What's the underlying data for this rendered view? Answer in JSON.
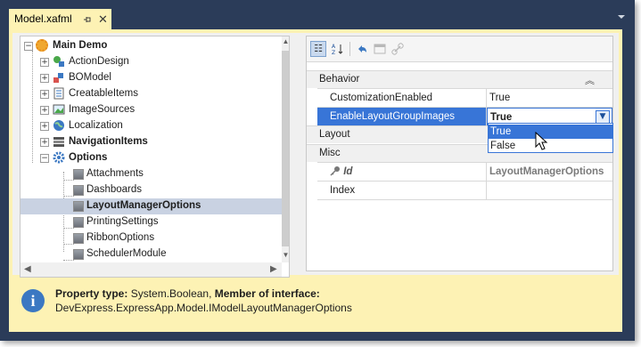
{
  "window": {
    "tab_title": "Model.xafml",
    "pin_glyph": "⌘",
    "close_glyph": "✕"
  },
  "tree": {
    "nodes": [
      {
        "label": "Main Demo",
        "bold": true,
        "expander": "−",
        "icon": "gear-orange-icon"
      },
      {
        "label": "ActionDesign",
        "bold": false,
        "expander": "+",
        "icon": "action-design-icon"
      },
      {
        "label": "BOModel",
        "bold": false,
        "expander": "+",
        "icon": "bomodel-icon"
      },
      {
        "label": "CreatableItems",
        "bold": false,
        "expander": "+",
        "icon": "creatable-items-icon"
      },
      {
        "label": "ImageSources",
        "bold": false,
        "expander": "+",
        "icon": "image-sources-icon"
      },
      {
        "label": "Localization",
        "bold": false,
        "expander": "+",
        "icon": "globe-icon"
      },
      {
        "label": "NavigationItems",
        "bold": true,
        "expander": "+",
        "icon": "navigation-icon"
      },
      {
        "label": "Options",
        "bold": true,
        "expander": "−",
        "icon": "gear-blue-icon"
      },
      {
        "label": "Attachments",
        "bold": false,
        "icon": "node-square-icon"
      },
      {
        "label": "Dashboards",
        "bold": false,
        "icon": "node-square-icon"
      },
      {
        "label": "LayoutManagerOptions",
        "bold": true,
        "icon": "node-square-icon",
        "selected": true
      },
      {
        "label": "PrintingSettings",
        "bold": false,
        "icon": "node-square-icon"
      },
      {
        "label": "RibbonOptions",
        "bold": false,
        "icon": "node-square-icon"
      },
      {
        "label": "SchedulerModule",
        "bold": false,
        "icon": "node-square-icon"
      }
    ]
  },
  "property_grid": {
    "categories": {
      "behavior": "Behavior",
      "layout": "Layout",
      "misc": "Misc"
    },
    "rows": {
      "customization_name": "CustomizationEnabled",
      "customization_value": "True",
      "enable_lgi_name": "EnableLayoutGroupImages",
      "enable_lgi_value": "True",
      "id_name": "Id",
      "id_value": "LayoutManagerOptions",
      "index_name": "Index",
      "index_value": ""
    },
    "dropdown_options": [
      "True",
      "False"
    ],
    "highlighted_option": "True"
  },
  "info": {
    "label_property_type": "Property type:",
    "property_type": "System.Boolean,",
    "label_member": "Member of interface:",
    "interface": "DevExpress.ExpressApp.Model.IModelLayoutManagerOptions"
  },
  "colors": {
    "chrome": "#2b3c59",
    "accent_yellow": "#fdf2b4",
    "selection_blue": "#3875d7",
    "tree_selection": "#c9d2e2"
  }
}
